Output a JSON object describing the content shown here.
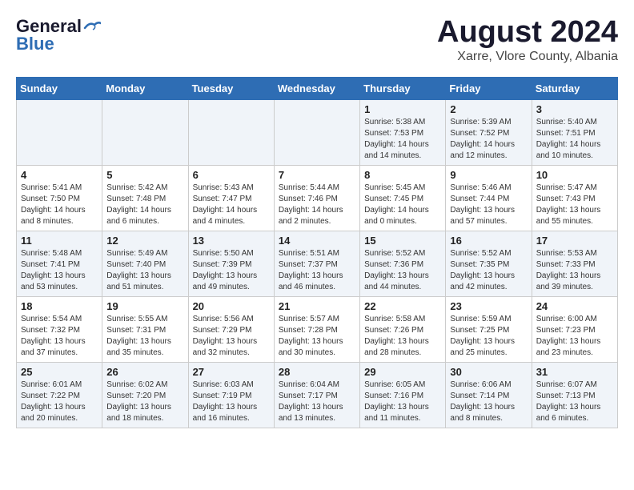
{
  "header": {
    "logo_line1": "General",
    "logo_line2": "Blue",
    "title": "August 2024",
    "subtitle": "Xarre, Vlore County, Albania"
  },
  "weekdays": [
    "Sunday",
    "Monday",
    "Tuesday",
    "Wednesday",
    "Thursday",
    "Friday",
    "Saturday"
  ],
  "weeks": [
    [
      {
        "day": "",
        "sunrise": "",
        "sunset": "",
        "daylight": ""
      },
      {
        "day": "",
        "sunrise": "",
        "sunset": "",
        "daylight": ""
      },
      {
        "day": "",
        "sunrise": "",
        "sunset": "",
        "daylight": ""
      },
      {
        "day": "",
        "sunrise": "",
        "sunset": "",
        "daylight": ""
      },
      {
        "day": "1",
        "sunrise": "Sunrise: 5:38 AM",
        "sunset": "Sunset: 7:53 PM",
        "daylight": "Daylight: 14 hours and 14 minutes."
      },
      {
        "day": "2",
        "sunrise": "Sunrise: 5:39 AM",
        "sunset": "Sunset: 7:52 PM",
        "daylight": "Daylight: 14 hours and 12 minutes."
      },
      {
        "day": "3",
        "sunrise": "Sunrise: 5:40 AM",
        "sunset": "Sunset: 7:51 PM",
        "daylight": "Daylight: 14 hours and 10 minutes."
      }
    ],
    [
      {
        "day": "4",
        "sunrise": "Sunrise: 5:41 AM",
        "sunset": "Sunset: 7:50 PM",
        "daylight": "Daylight: 14 hours and 8 minutes."
      },
      {
        "day": "5",
        "sunrise": "Sunrise: 5:42 AM",
        "sunset": "Sunset: 7:48 PM",
        "daylight": "Daylight: 14 hours and 6 minutes."
      },
      {
        "day": "6",
        "sunrise": "Sunrise: 5:43 AM",
        "sunset": "Sunset: 7:47 PM",
        "daylight": "Daylight: 14 hours and 4 minutes."
      },
      {
        "day": "7",
        "sunrise": "Sunrise: 5:44 AM",
        "sunset": "Sunset: 7:46 PM",
        "daylight": "Daylight: 14 hours and 2 minutes."
      },
      {
        "day": "8",
        "sunrise": "Sunrise: 5:45 AM",
        "sunset": "Sunset: 7:45 PM",
        "daylight": "Daylight: 14 hours and 0 minutes."
      },
      {
        "day": "9",
        "sunrise": "Sunrise: 5:46 AM",
        "sunset": "Sunset: 7:44 PM",
        "daylight": "Daylight: 13 hours and 57 minutes."
      },
      {
        "day": "10",
        "sunrise": "Sunrise: 5:47 AM",
        "sunset": "Sunset: 7:43 PM",
        "daylight": "Daylight: 13 hours and 55 minutes."
      }
    ],
    [
      {
        "day": "11",
        "sunrise": "Sunrise: 5:48 AM",
        "sunset": "Sunset: 7:41 PM",
        "daylight": "Daylight: 13 hours and 53 minutes."
      },
      {
        "day": "12",
        "sunrise": "Sunrise: 5:49 AM",
        "sunset": "Sunset: 7:40 PM",
        "daylight": "Daylight: 13 hours and 51 minutes."
      },
      {
        "day": "13",
        "sunrise": "Sunrise: 5:50 AM",
        "sunset": "Sunset: 7:39 PM",
        "daylight": "Daylight: 13 hours and 49 minutes."
      },
      {
        "day": "14",
        "sunrise": "Sunrise: 5:51 AM",
        "sunset": "Sunset: 7:37 PM",
        "daylight": "Daylight: 13 hours and 46 minutes."
      },
      {
        "day": "15",
        "sunrise": "Sunrise: 5:52 AM",
        "sunset": "Sunset: 7:36 PM",
        "daylight": "Daylight: 13 hours and 44 minutes."
      },
      {
        "day": "16",
        "sunrise": "Sunrise: 5:52 AM",
        "sunset": "Sunset: 7:35 PM",
        "daylight": "Daylight: 13 hours and 42 minutes."
      },
      {
        "day": "17",
        "sunrise": "Sunrise: 5:53 AM",
        "sunset": "Sunset: 7:33 PM",
        "daylight": "Daylight: 13 hours and 39 minutes."
      }
    ],
    [
      {
        "day": "18",
        "sunrise": "Sunrise: 5:54 AM",
        "sunset": "Sunset: 7:32 PM",
        "daylight": "Daylight: 13 hours and 37 minutes."
      },
      {
        "day": "19",
        "sunrise": "Sunrise: 5:55 AM",
        "sunset": "Sunset: 7:31 PM",
        "daylight": "Daylight: 13 hours and 35 minutes."
      },
      {
        "day": "20",
        "sunrise": "Sunrise: 5:56 AM",
        "sunset": "Sunset: 7:29 PM",
        "daylight": "Daylight: 13 hours and 32 minutes."
      },
      {
        "day": "21",
        "sunrise": "Sunrise: 5:57 AM",
        "sunset": "Sunset: 7:28 PM",
        "daylight": "Daylight: 13 hours and 30 minutes."
      },
      {
        "day": "22",
        "sunrise": "Sunrise: 5:58 AM",
        "sunset": "Sunset: 7:26 PM",
        "daylight": "Daylight: 13 hours and 28 minutes."
      },
      {
        "day": "23",
        "sunrise": "Sunrise: 5:59 AM",
        "sunset": "Sunset: 7:25 PM",
        "daylight": "Daylight: 13 hours and 25 minutes."
      },
      {
        "day": "24",
        "sunrise": "Sunrise: 6:00 AM",
        "sunset": "Sunset: 7:23 PM",
        "daylight": "Daylight: 13 hours and 23 minutes."
      }
    ],
    [
      {
        "day": "25",
        "sunrise": "Sunrise: 6:01 AM",
        "sunset": "Sunset: 7:22 PM",
        "daylight": "Daylight: 13 hours and 20 minutes."
      },
      {
        "day": "26",
        "sunrise": "Sunrise: 6:02 AM",
        "sunset": "Sunset: 7:20 PM",
        "daylight": "Daylight: 13 hours and 18 minutes."
      },
      {
        "day": "27",
        "sunrise": "Sunrise: 6:03 AM",
        "sunset": "Sunset: 7:19 PM",
        "daylight": "Daylight: 13 hours and 16 minutes."
      },
      {
        "day": "28",
        "sunrise": "Sunrise: 6:04 AM",
        "sunset": "Sunset: 7:17 PM",
        "daylight": "Daylight: 13 hours and 13 minutes."
      },
      {
        "day": "29",
        "sunrise": "Sunrise: 6:05 AM",
        "sunset": "Sunset: 7:16 PM",
        "daylight": "Daylight: 13 hours and 11 minutes."
      },
      {
        "day": "30",
        "sunrise": "Sunrise: 6:06 AM",
        "sunset": "Sunset: 7:14 PM",
        "daylight": "Daylight: 13 hours and 8 minutes."
      },
      {
        "day": "31",
        "sunrise": "Sunrise: 6:07 AM",
        "sunset": "Sunset: 7:13 PM",
        "daylight": "Daylight: 13 hours and 6 minutes."
      }
    ]
  ]
}
